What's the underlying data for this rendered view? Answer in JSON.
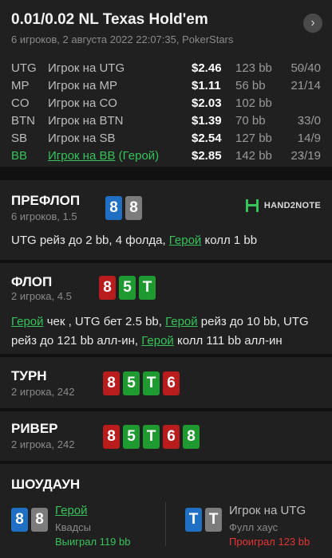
{
  "header": {
    "title": "0.01/0.02 NL Texas Hold'em",
    "subtitle": "6 игроков, 2 августа 2022 22:07:35, PokerStars"
  },
  "seats": [
    {
      "pos": "UTG",
      "name": "Игрок на UTG",
      "stack": "$2.46",
      "bb": "123 bb",
      "sep": "·",
      "stat": "50/40"
    },
    {
      "pos": "MP",
      "name": "Игрок на MP",
      "stack": "$1.11",
      "bb": "56 bb",
      "sep": "·",
      "stat": "21/14"
    },
    {
      "pos": "CO",
      "name": "Игрок на CO",
      "stack": "$2.03",
      "bb": "102 bb",
      "sep": "",
      "stat": ""
    },
    {
      "pos": "BTN",
      "name": "Игрок на BTN",
      "stack": "$1.39",
      "bb": "70 bb",
      "sep": "·",
      "stat": "33/0"
    },
    {
      "pos": "SB",
      "name": "Игрок на SB",
      "stack": "$2.54",
      "bb": "127 bb",
      "sep": "·",
      "stat": "14/9"
    },
    {
      "pos": "BB",
      "name": "Игрок на BB",
      "hero_tag": "(Герой)",
      "stack": "$2.85",
      "bb": "142 bb",
      "sep": "·",
      "stat": "23/19"
    }
  ],
  "logo": {
    "text": "HAND2NOTE",
    "color": "#35c35a"
  },
  "preflop": {
    "title": "ПРЕФЛОП",
    "sub": "6 игроков, 1.5",
    "cards": [
      "8",
      "8"
    ],
    "action": {
      "p1": "UTG рейз до 2 bb, 4 фолда, ",
      "hero": "Герой",
      "p2": " колл 1 bb"
    }
  },
  "flop": {
    "title": "ФЛОП",
    "sub": "2 игрока, 4.5",
    "cards": [
      "8",
      "5",
      "T"
    ],
    "action": {
      "hero1": "Герой",
      "p1": " чек , UTG бет 2.5 bb, ",
      "hero2": "Герой",
      "p2": " рейз до 10 bb, UTG",
      "p3": "рейз до 121 bb алл-ин, ",
      "hero3": "Герой",
      "p4": " колл 111 bb алл-ин"
    }
  },
  "turn": {
    "title": "ТУРН",
    "sub": "2 игрока, 242",
    "cards": [
      "8",
      "5",
      "T",
      "6"
    ]
  },
  "river": {
    "title": "РИВЕР",
    "sub": "2 игрока, 242",
    "cards": [
      "8",
      "5",
      "T",
      "6",
      "8"
    ]
  },
  "showdown": {
    "title": "ШОУДАУН",
    "hero": {
      "cards": [
        "8",
        "8"
      ],
      "name": "Герой",
      "hand": "Квадсы",
      "result": "Выиграл 119 bb"
    },
    "villain": {
      "cards": [
        "T",
        "T"
      ],
      "name": "Игрок на UTG",
      "hand": "Фулл хаус",
      "result": "Проиграл 123 bb"
    }
  },
  "colors": {
    "hero_green": "#35c35a",
    "loss_red": "#e53535",
    "spade_blue": "#1f6fc4",
    "club_gray": "#7c7c7c",
    "heart_red": "#b81c1c",
    "diamond_green": "#1f9a31"
  }
}
